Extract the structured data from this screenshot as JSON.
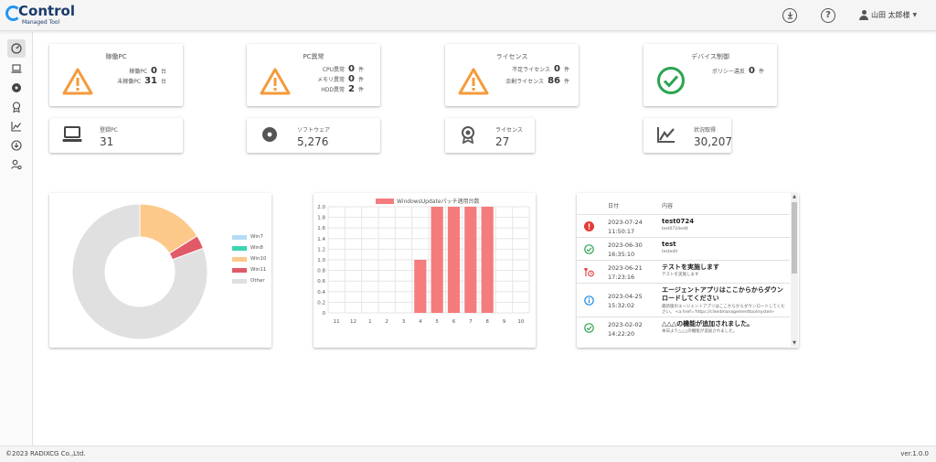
{
  "app": {
    "logo_text": "Control",
    "logo_sub": "Managed Tool"
  },
  "header": {
    "user_name": "山田 太郎様"
  },
  "status_cards": [
    {
      "title": "稼働PC",
      "rows": [
        {
          "label": "稼働PC",
          "value": "0",
          "unit": "台"
        },
        {
          "label": "未稼働PC",
          "value": "31",
          "unit": "台"
        }
      ]
    },
    {
      "title": "PC異常",
      "rows": [
        {
          "label": "CPU異常",
          "value": "0",
          "unit": "件"
        },
        {
          "label": "メモリ異常",
          "value": "0",
          "unit": "件"
        },
        {
          "label": "HDD異常",
          "value": "2",
          "unit": "件"
        }
      ]
    },
    {
      "title": "ライセンス",
      "rows": [
        {
          "label": "不足ライセンス",
          "value": "0",
          "unit": "件"
        },
        {
          "label": "余剰ライセンス",
          "value": "86",
          "unit": "件"
        }
      ]
    },
    {
      "title": "デバイス制御",
      "rows": [
        {
          "label": "ポリシー違反",
          "value": "0",
          "unit": "件"
        }
      ]
    }
  ],
  "mini_cards": [
    {
      "label": "登録PC",
      "value": "31",
      "icon": "laptop-icon"
    },
    {
      "label": "ソフトウェア",
      "value": "5,276",
      "icon": "disc-icon"
    },
    {
      "label": "ライセンス",
      "value": "27",
      "icon": "license-badge-icon"
    },
    {
      "label": "状況取得",
      "value": "30,207",
      "icon": "line-chart-icon"
    }
  ],
  "donut": {
    "legend": [
      {
        "name": "Win7",
        "color": "#b3dcf5"
      },
      {
        "name": "Win8",
        "color": "#3dd5b0"
      },
      {
        "name": "Win10",
        "color": "#fcc98a"
      },
      {
        "name": "Win11",
        "color": "#e05a68"
      },
      {
        "name": "Other",
        "color": "#e0e0e0"
      }
    ]
  },
  "chart_data": [
    {
      "type": "pie",
      "subtype": "donut",
      "categories": [
        "Win7",
        "Win8",
        "Win10",
        "Win11",
        "Other"
      ],
      "values": [
        0,
        0,
        5,
        1,
        25
      ],
      "colors": [
        "#b3dcf5",
        "#3dd5b0",
        "#fcc98a",
        "#e05a68",
        "#e0e0e0"
      ],
      "legend": "right"
    },
    {
      "type": "bar",
      "series": [
        {
          "name": "WindowsUpdateパッチ適用台数",
          "color": "#f47c7c",
          "values": [
            0,
            0,
            0,
            0,
            0,
            1,
            2,
            2,
            2,
            2,
            0,
            0
          ]
        }
      ],
      "categories": [
        "11",
        "12",
        "1",
        "2",
        "3",
        "4",
        "5",
        "6",
        "7",
        "8",
        "9",
        "10"
      ],
      "yticks": [
        "0",
        "0.2",
        "0.4",
        "0.6",
        "0.8",
        "1.0",
        "1.2",
        "1.4",
        "1.6",
        "1.8",
        "2.0"
      ],
      "ylim": [
        0,
        2
      ],
      "grid": true,
      "legend": "top"
    }
  ],
  "notifications": {
    "headers": {
      "date": "日付",
      "content": "内容"
    },
    "rows": [
      {
        "icon": "error-icon",
        "date": "2023-07-24 11:50:17",
        "title": "test0724",
        "sub": "test0724edit"
      },
      {
        "icon": "check-circle-icon",
        "date": "2023-06-30 16:35:10",
        "title": "test",
        "sub": "testedit"
      },
      {
        "icon": "maintenance-icon",
        "date": "2023-06-21 17:23:16",
        "title": "テストを実施します",
        "sub": "テストを実施します"
      },
      {
        "icon": "info-icon",
        "date": "2023-04-25 15:32:02",
        "title": "エージェントアプリはここからからダウンロードしてください",
        "sub": "最新版のエージェントアプリはここからからダウンロードしてください。 <a href='https://clientmanagementtool/system-"
      },
      {
        "icon": "check-circle-icon",
        "date": "2023-02-02 14:22:20",
        "title": "△△△の機能が追加されました。",
        "sub": "本日より△△△の機能が追加されました。"
      }
    ]
  },
  "footer": {
    "copyright": "©2023 RADIXCG Co.,Ltd.",
    "version": "ver.1.0.0"
  }
}
